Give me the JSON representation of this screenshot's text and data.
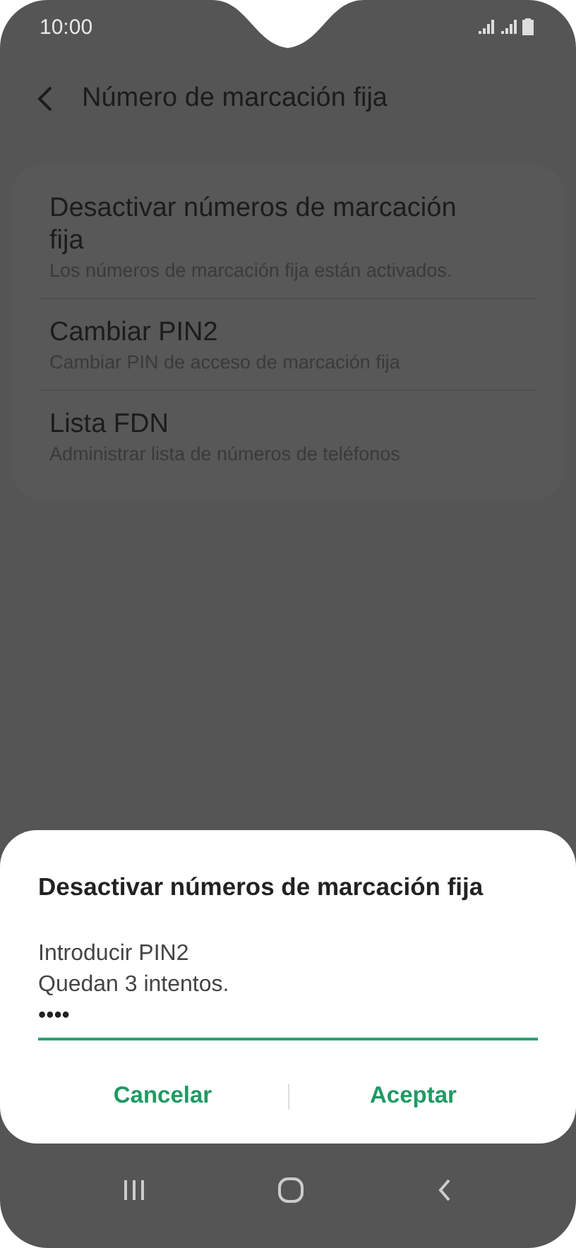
{
  "status_bar": {
    "time": "10:00"
  },
  "header": {
    "title": "Número de marcación fija"
  },
  "settings": [
    {
      "title": "Desactivar números de marcación fija",
      "subtitle": "Los números de marcación fija están activados."
    },
    {
      "title": "Cambiar PIN2",
      "subtitle": "Cambiar PIN de acceso de marcación fija"
    },
    {
      "title": "Lista FDN",
      "subtitle": "Administrar lista de números de teléfonos"
    }
  ],
  "dialog": {
    "title": "Desactivar números de marcación fija",
    "message": [
      "Introducir PIN2",
      "Quedan 3 intentos."
    ],
    "field": {
      "value": "••••"
    },
    "buttons": [
      "Cancelar",
      "Aceptar"
    ]
  }
}
